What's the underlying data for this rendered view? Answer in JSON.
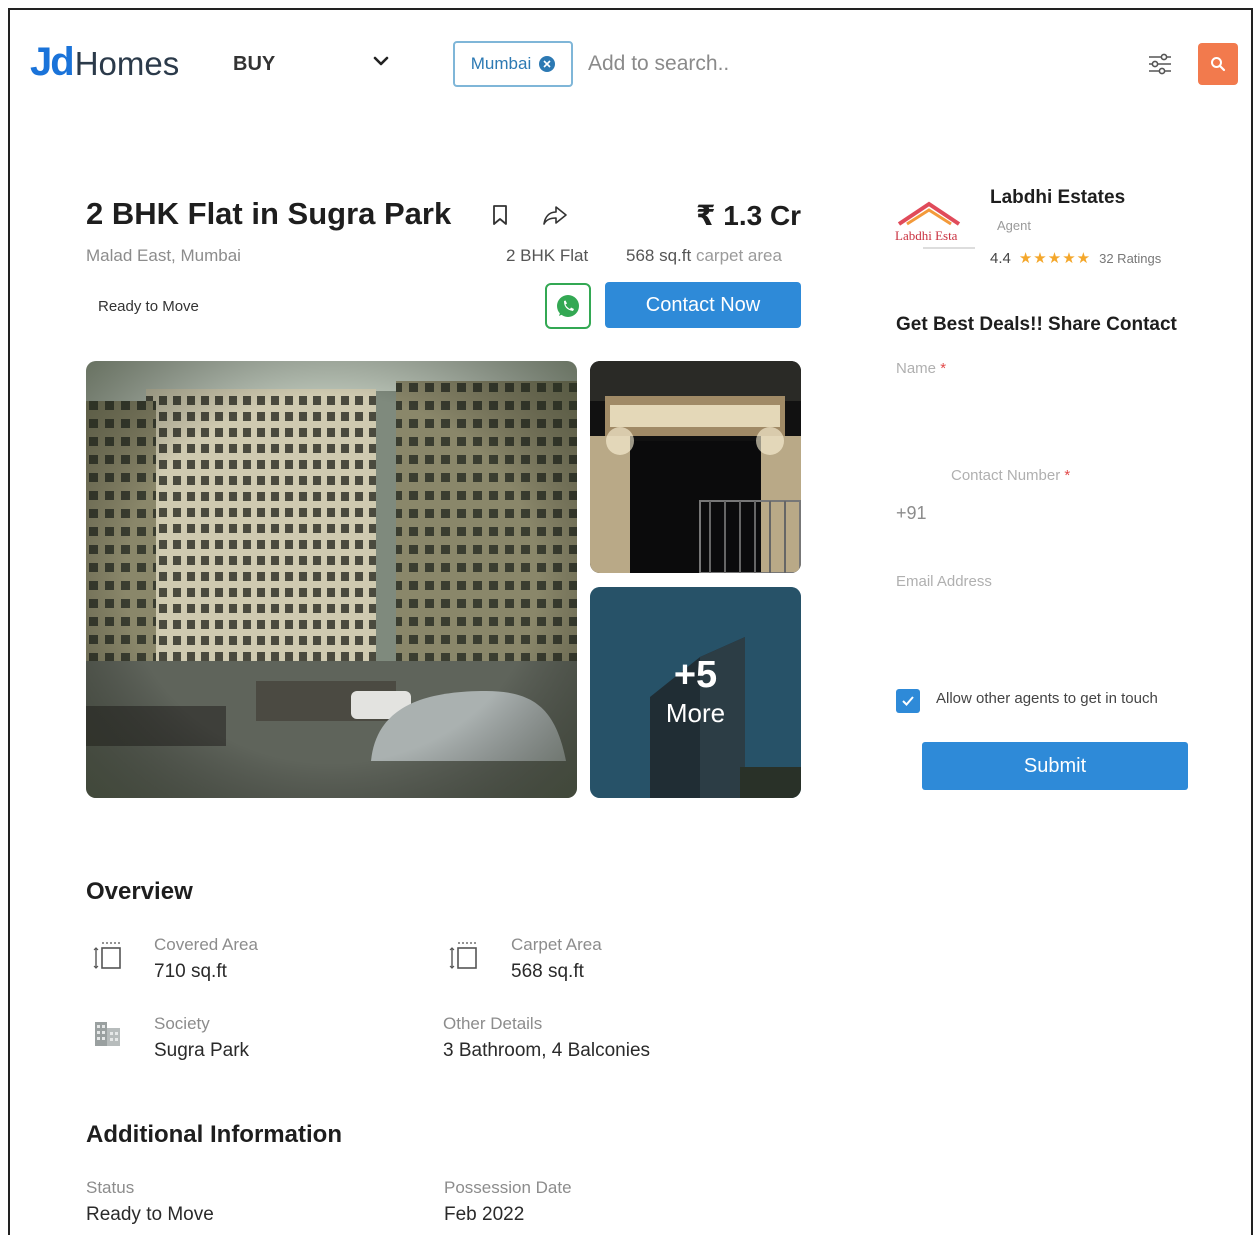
{
  "header": {
    "logo_jd": "Jd",
    "logo_homes": "Homes",
    "mode_label": "BUY",
    "city_chip": "Mumbai",
    "search_placeholder": "Add to search.."
  },
  "listing": {
    "title": "2 BHK Flat in Sugra Park",
    "price": "₹ 1.3 Cr",
    "locality": "Malad East, Mumbai",
    "bhk": "2 BHK Flat",
    "area_value": "568 sq.ft",
    "area_type": "carpet area",
    "status_badge": "Ready to Move",
    "contact_label": "Contact Now"
  },
  "gallery": {
    "more_count": "+5",
    "more_label": "More"
  },
  "agent": {
    "name": "Labdhi Estates",
    "role": "Agent",
    "logo_text": "Labdhi Esta",
    "rating": "4.4",
    "stars": "★★★★★",
    "ratings_count": "32 Ratings"
  },
  "lead_form": {
    "title": "Get Best Deals!! Share Contact",
    "name_label": "Name",
    "required_mark": "*",
    "contact_label": "Contact Number",
    "phone_prefix": "+91",
    "email_placeholder": "Email Address",
    "consent_text": "Allow other agents to get in touch",
    "consent_checked": true,
    "submit_label": "Submit"
  },
  "overview": {
    "title": "Overview",
    "items": [
      {
        "label": "Covered Area",
        "value": "710 sq.ft"
      },
      {
        "label": "Carpet Area",
        "value": "568 sq.ft"
      },
      {
        "label": "Society",
        "value": "Sugra Park"
      },
      {
        "label": "Other Details",
        "value": "3 Bathroom, 4 Balconies"
      }
    ]
  },
  "additional": {
    "title": "Additional Information",
    "items": [
      {
        "label": "Status",
        "value": "Ready to Move"
      },
      {
        "label": "Possession Date",
        "value": "Feb 2022"
      }
    ]
  },
  "colors": {
    "primary_blue": "#2e8ad8",
    "search_orange": "#f27a4d",
    "whatsapp_green": "#33a853",
    "star_gold": "#f4a72b"
  },
  "icons": [
    "chevron-down-icon",
    "close-icon",
    "filter-icon",
    "search-icon",
    "bookmark-icon",
    "share-icon",
    "whatsapp-icon",
    "check-icon",
    "area-icon",
    "building-icon"
  ]
}
